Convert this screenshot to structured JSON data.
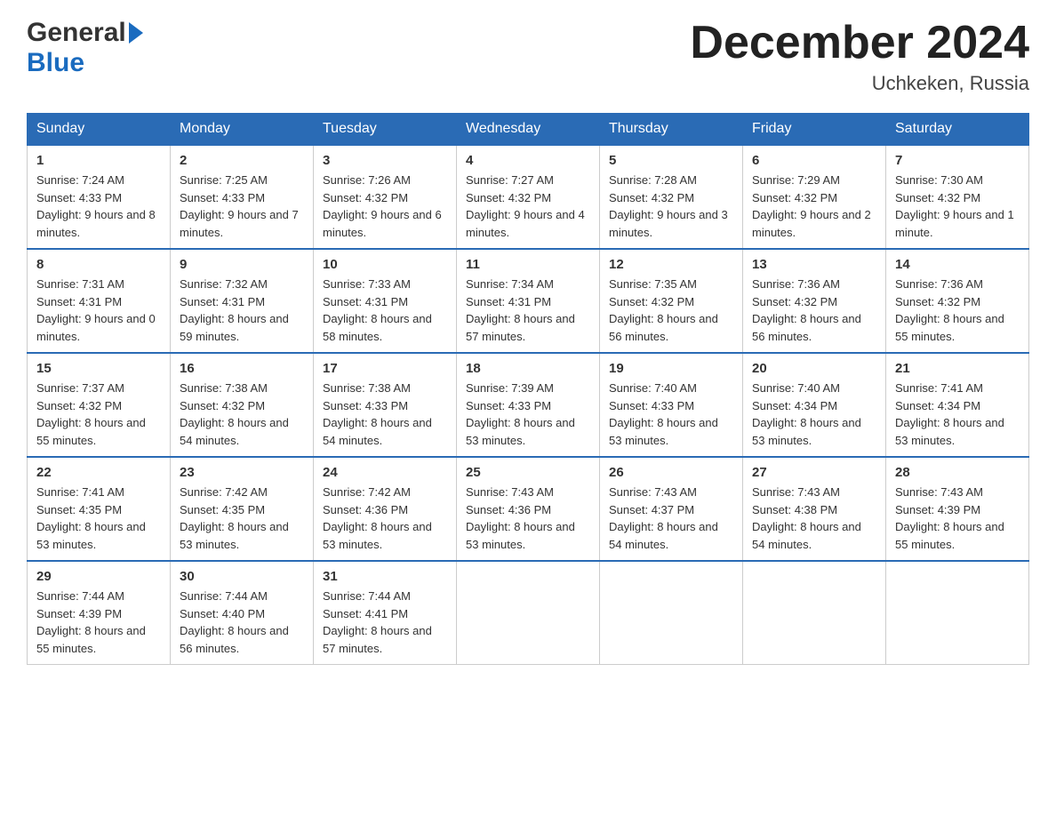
{
  "logo": {
    "general": "General",
    "blue": "Blue"
  },
  "header": {
    "title": "December 2024",
    "location": "Uchkeken, Russia"
  },
  "days_of_week": [
    "Sunday",
    "Monday",
    "Tuesday",
    "Wednesday",
    "Thursday",
    "Friday",
    "Saturday"
  ],
  "weeks": [
    [
      {
        "day": "1",
        "sunrise": "7:24 AM",
        "sunset": "4:33 PM",
        "daylight": "9 hours and 8 minutes."
      },
      {
        "day": "2",
        "sunrise": "7:25 AM",
        "sunset": "4:33 PM",
        "daylight": "9 hours and 7 minutes."
      },
      {
        "day": "3",
        "sunrise": "7:26 AM",
        "sunset": "4:32 PM",
        "daylight": "9 hours and 6 minutes."
      },
      {
        "day": "4",
        "sunrise": "7:27 AM",
        "sunset": "4:32 PM",
        "daylight": "9 hours and 4 minutes."
      },
      {
        "day": "5",
        "sunrise": "7:28 AM",
        "sunset": "4:32 PM",
        "daylight": "9 hours and 3 minutes."
      },
      {
        "day": "6",
        "sunrise": "7:29 AM",
        "sunset": "4:32 PM",
        "daylight": "9 hours and 2 minutes."
      },
      {
        "day": "7",
        "sunrise": "7:30 AM",
        "sunset": "4:32 PM",
        "daylight": "9 hours and 1 minute."
      }
    ],
    [
      {
        "day": "8",
        "sunrise": "7:31 AM",
        "sunset": "4:31 PM",
        "daylight": "9 hours and 0 minutes."
      },
      {
        "day": "9",
        "sunrise": "7:32 AM",
        "sunset": "4:31 PM",
        "daylight": "8 hours and 59 minutes."
      },
      {
        "day": "10",
        "sunrise": "7:33 AM",
        "sunset": "4:31 PM",
        "daylight": "8 hours and 58 minutes."
      },
      {
        "day": "11",
        "sunrise": "7:34 AM",
        "sunset": "4:31 PM",
        "daylight": "8 hours and 57 minutes."
      },
      {
        "day": "12",
        "sunrise": "7:35 AM",
        "sunset": "4:32 PM",
        "daylight": "8 hours and 56 minutes."
      },
      {
        "day": "13",
        "sunrise": "7:36 AM",
        "sunset": "4:32 PM",
        "daylight": "8 hours and 56 minutes."
      },
      {
        "day": "14",
        "sunrise": "7:36 AM",
        "sunset": "4:32 PM",
        "daylight": "8 hours and 55 minutes."
      }
    ],
    [
      {
        "day": "15",
        "sunrise": "7:37 AM",
        "sunset": "4:32 PM",
        "daylight": "8 hours and 55 minutes."
      },
      {
        "day": "16",
        "sunrise": "7:38 AM",
        "sunset": "4:32 PM",
        "daylight": "8 hours and 54 minutes."
      },
      {
        "day": "17",
        "sunrise": "7:38 AM",
        "sunset": "4:33 PM",
        "daylight": "8 hours and 54 minutes."
      },
      {
        "day": "18",
        "sunrise": "7:39 AM",
        "sunset": "4:33 PM",
        "daylight": "8 hours and 53 minutes."
      },
      {
        "day": "19",
        "sunrise": "7:40 AM",
        "sunset": "4:33 PM",
        "daylight": "8 hours and 53 minutes."
      },
      {
        "day": "20",
        "sunrise": "7:40 AM",
        "sunset": "4:34 PM",
        "daylight": "8 hours and 53 minutes."
      },
      {
        "day": "21",
        "sunrise": "7:41 AM",
        "sunset": "4:34 PM",
        "daylight": "8 hours and 53 minutes."
      }
    ],
    [
      {
        "day": "22",
        "sunrise": "7:41 AM",
        "sunset": "4:35 PM",
        "daylight": "8 hours and 53 minutes."
      },
      {
        "day": "23",
        "sunrise": "7:42 AM",
        "sunset": "4:35 PM",
        "daylight": "8 hours and 53 minutes."
      },
      {
        "day": "24",
        "sunrise": "7:42 AM",
        "sunset": "4:36 PM",
        "daylight": "8 hours and 53 minutes."
      },
      {
        "day": "25",
        "sunrise": "7:43 AM",
        "sunset": "4:36 PM",
        "daylight": "8 hours and 53 minutes."
      },
      {
        "day": "26",
        "sunrise": "7:43 AM",
        "sunset": "4:37 PM",
        "daylight": "8 hours and 54 minutes."
      },
      {
        "day": "27",
        "sunrise": "7:43 AM",
        "sunset": "4:38 PM",
        "daylight": "8 hours and 54 minutes."
      },
      {
        "day": "28",
        "sunrise": "7:43 AM",
        "sunset": "4:39 PM",
        "daylight": "8 hours and 55 minutes."
      }
    ],
    [
      {
        "day": "29",
        "sunrise": "7:44 AM",
        "sunset": "4:39 PM",
        "daylight": "8 hours and 55 minutes."
      },
      {
        "day": "30",
        "sunrise": "7:44 AM",
        "sunset": "4:40 PM",
        "daylight": "8 hours and 56 minutes."
      },
      {
        "day": "31",
        "sunrise": "7:44 AM",
        "sunset": "4:41 PM",
        "daylight": "8 hours and 57 minutes."
      },
      null,
      null,
      null,
      null
    ]
  ]
}
